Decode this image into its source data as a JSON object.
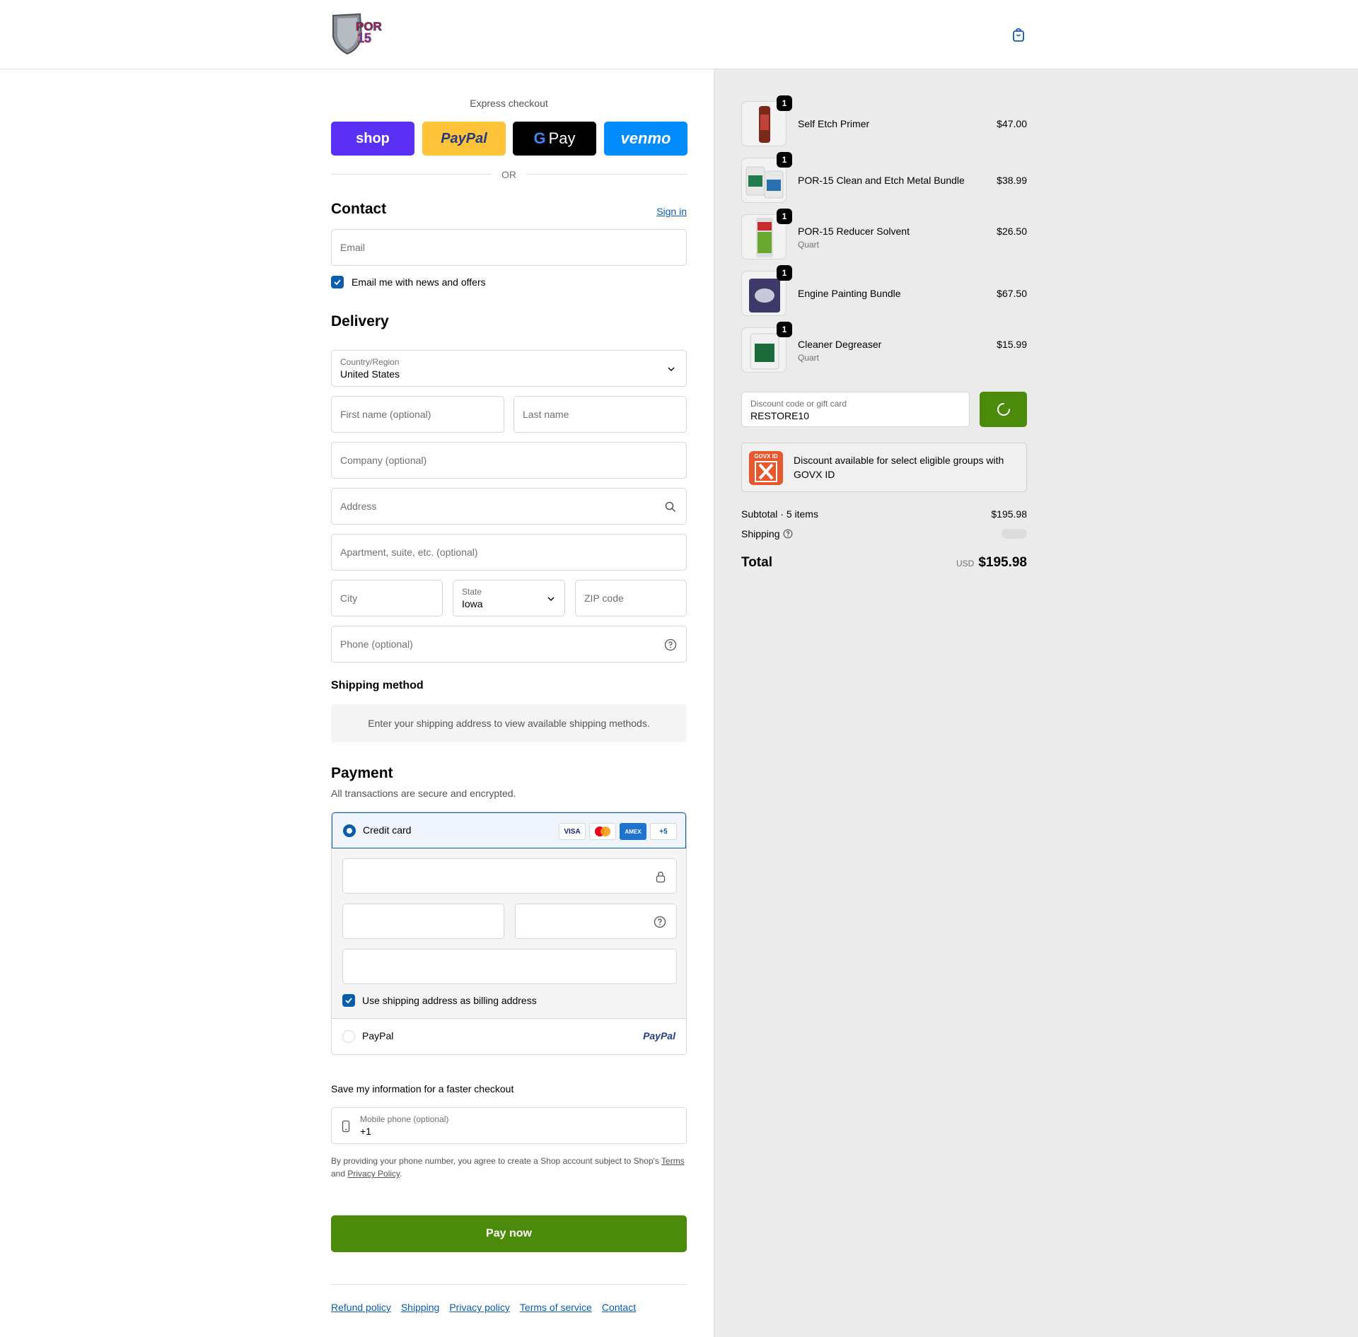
{
  "header": {
    "logo_text": "POR 15"
  },
  "express": {
    "title": "Express checkout",
    "shop_label": "shop",
    "paypal_label": "PayPal",
    "gpay_label": "Pay",
    "venmo_label": "venmo",
    "or_label": "OR",
    "colors": {
      "shop": "#5a31f4",
      "paypal": "#ffc439",
      "gpay": "#000000",
      "venmo": "#008cff"
    }
  },
  "contact": {
    "title": "Contact",
    "sign_in": "Sign in",
    "email_placeholder": "Email",
    "newsletter_label": "Email me with news and offers",
    "newsletter_checked": true
  },
  "delivery": {
    "title": "Delivery",
    "country_label": "Country/Region",
    "country_value": "United States",
    "first_name_placeholder": "First name (optional)",
    "last_name_placeholder": "Last name",
    "company_placeholder": "Company (optional)",
    "address_placeholder": "Address",
    "apartment_placeholder": "Apartment, suite, etc. (optional)",
    "city_placeholder": "City",
    "state_label": "State",
    "state_value": "Iowa",
    "zip_placeholder": "ZIP code",
    "phone_placeholder": "Phone (optional)"
  },
  "shipping_method": {
    "title": "Shipping method",
    "message": "Enter your shipping address to view available shipping methods."
  },
  "payment": {
    "title": "Payment",
    "subtitle": "All transactions are secure and encrypted.",
    "credit_card_label": "Credit card",
    "card_badges": [
      "VISA",
      "",
      "AMEX",
      "+5"
    ],
    "billing_same_label": "Use shipping address as billing address",
    "billing_same_checked": true,
    "paypal_label": "PayPal",
    "paypal_logo": "PayPal"
  },
  "save_info": {
    "title": "Save my information for a faster checkout",
    "mobile_label": "Mobile phone (optional)",
    "mobile_value": "+1",
    "legal_prefix": "By providing your phone number, you agree to create a Shop account subject to Shop's ",
    "legal_terms": "Terms",
    "legal_and": "and ",
    "legal_privacy": "Privacy Policy",
    "legal_suffix": "."
  },
  "pay_now_label": "Pay now",
  "footer_links": [
    "Refund policy",
    "Shipping",
    "Privacy policy",
    "Terms of service",
    "Contact"
  ],
  "order": {
    "items": [
      {
        "name": "Self Etch Primer",
        "variant": "",
        "price": "$47.00",
        "qty": "1"
      },
      {
        "name": "POR-15 Clean and Etch Metal Bundle",
        "variant": "",
        "price": "$38.99",
        "qty": "1"
      },
      {
        "name": "POR-15 Reducer Solvent",
        "variant": "Quart",
        "price": "$26.50",
        "qty": "1"
      },
      {
        "name": "Engine Painting Bundle",
        "variant": "",
        "price": "$67.50",
        "qty": "1"
      },
      {
        "name": "Cleaner Degreaser",
        "variant": "Quart",
        "price": "$15.99",
        "qty": "1"
      }
    ],
    "discount_label": "Discount code or gift card",
    "discount_value": "RESTORE10",
    "govx_text": "Discount available for select eligible groups with GOVX ID",
    "govx_logo_text": "GOVX ID",
    "subtotal_label": "Subtotal · 5 items",
    "subtotal_value": "$195.98",
    "shipping_label": "Shipping",
    "total_label": "Total",
    "currency": "USD",
    "total_value": "$195.98",
    "accent_color": "#4b8a0a"
  }
}
